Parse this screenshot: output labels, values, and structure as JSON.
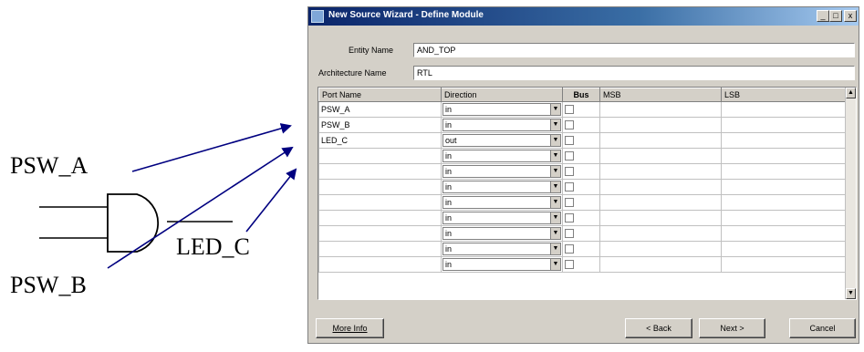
{
  "diagram": {
    "labels": {
      "psw_a": "PSW_A",
      "psw_b": "PSW_B",
      "led_c": "LED_C"
    }
  },
  "window": {
    "title": "New Source Wizard - Define Module",
    "controls": {
      "minimize": "_",
      "maximize": "□",
      "close": "x"
    }
  },
  "form": {
    "entity_label": "Entity Name",
    "entity_value": "AND_TOP",
    "architecture_label": "Architecture Name",
    "architecture_value": "RTL"
  },
  "table": {
    "headers": [
      "Port Name",
      "Direction",
      "Bus",
      "MSB",
      "LSB"
    ],
    "rows": [
      {
        "port": "PSW_A",
        "direction": "in"
      },
      {
        "port": "PSW_B",
        "direction": "in"
      },
      {
        "port": "LED_C",
        "direction": "out"
      },
      {
        "port": "",
        "direction": "in"
      },
      {
        "port": "",
        "direction": "in"
      },
      {
        "port": "",
        "direction": "in"
      },
      {
        "port": "",
        "direction": "in"
      },
      {
        "port": "",
        "direction": "in"
      },
      {
        "port": "",
        "direction": "in"
      },
      {
        "port": "",
        "direction": "in"
      },
      {
        "port": "",
        "direction": "in"
      }
    ],
    "scroll_up": "▲",
    "scroll_down": "▼",
    "dropdown_arrow": "▼"
  },
  "buttons": {
    "more_info": "More Info",
    "back": "< Back",
    "next": "Next >",
    "cancel": "Cancel"
  }
}
